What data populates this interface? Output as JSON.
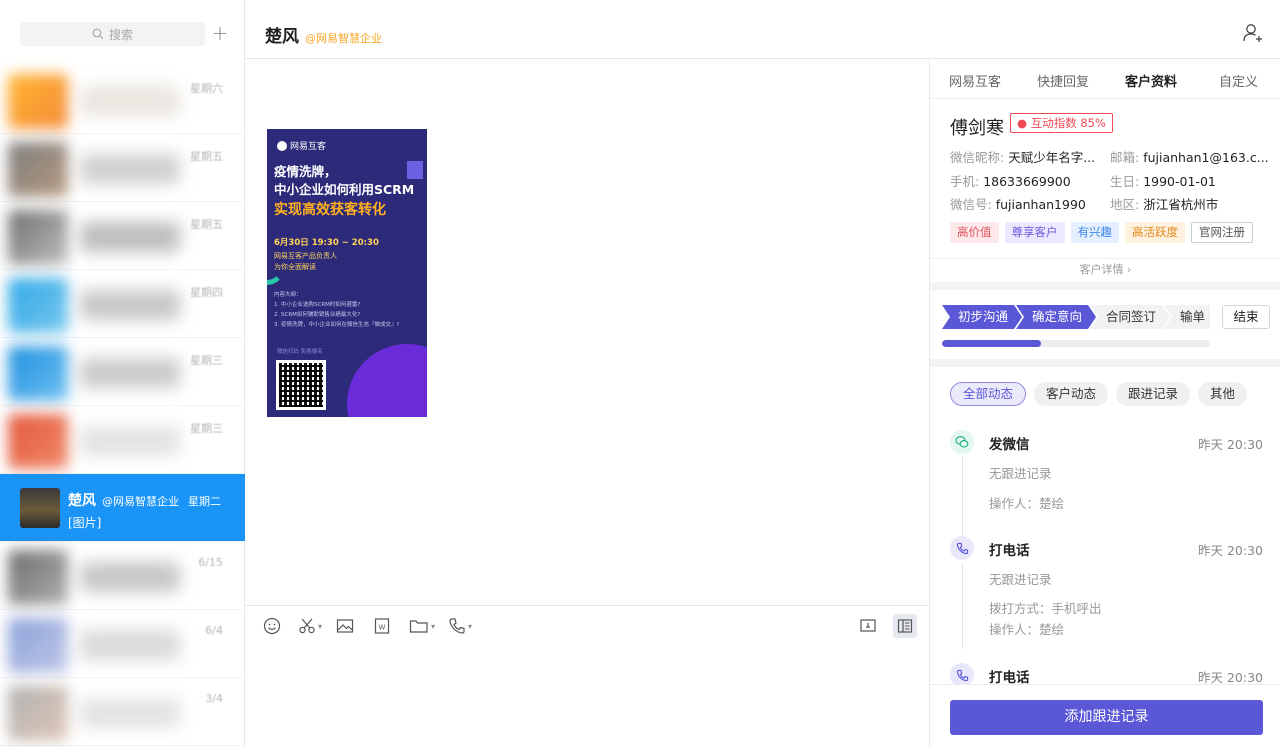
{
  "sidebar": {
    "search_placeholder": "搜索",
    "add_label": "+",
    "conversations": [
      {
        "date": "星期六",
        "colors": [
          "#ffb52e",
          "#f58a3a",
          "#d8d0c5"
        ]
      },
      {
        "date": "星期五",
        "colors": [
          "#7a7a7a",
          "#b99c83",
          "#aaa"
        ]
      },
      {
        "date": "星期五",
        "colors": [
          "#6d6d6d",
          "#c0c0c0",
          "#888"
        ]
      },
      {
        "date": "星期四",
        "colors": [
          "#2fa8e6",
          "#77c7ef",
          "#9a9a9a"
        ]
      },
      {
        "date": "星期三",
        "colors": [
          "#1e90e0",
          "#6ec0f0",
          "#a0a0a0"
        ]
      },
      {
        "date": "星期三",
        "colors": [
          "#e4563a",
          "#f08a6a",
          "#ccc"
        ]
      }
    ],
    "active": {
      "name": "楚风",
      "org": "@网易智慧企业",
      "day": "星期二",
      "message": "[图片]"
    },
    "after": [
      {
        "date": "6/15",
        "colors": [
          "#6d6d6d",
          "#b0b0b0",
          "#999"
        ]
      },
      {
        "date": "6/4",
        "colors": [
          "#8aa0d8",
          "#c0c8e8",
          "#bbb"
        ]
      },
      {
        "date": "3/4",
        "colors": [
          "#b0b0b0",
          "#e0c8b8",
          "#ccc"
        ]
      }
    ]
  },
  "chat": {
    "title": "楚风",
    "org": "@网易智慧企业",
    "poster": {
      "brand": "网易互客",
      "line1": "疫情洗牌，",
      "line2": "中小企业如何利用SCRM",
      "line3": "实现高效获客转化",
      "date": "6月30日  19:30 ~ 20:30",
      "speaker": "网易互客产品负责人",
      "speaker_sub": "为你全面解读",
      "outline_title": "内容大纲：",
      "outline_1": "1. 中小企业选购SCRM时如何避雷?",
      "outline_2": "2. SCRM如何辅助销售业绩最大化?",
      "outline_3": "3. 疫情洗牌，中小企业如何在微信生态『做成交』?",
      "register": "微信扫码  免费报名"
    }
  },
  "right": {
    "tabs": [
      "网易互客",
      "快捷回复",
      "客户资料",
      "自定义"
    ],
    "active_tab": 2,
    "customer": {
      "name": "傅剑寒",
      "score": "互动指数 85%",
      "wechat_nick_label": "微信昵称:",
      "wechat_nick": "天赋少年名字...",
      "email_label": "邮箱:",
      "email": "fujianhan1@163.c...",
      "phone_label": "手机:",
      "phone": "18633669900",
      "birthday_label": "生日:",
      "birthday": "1990-01-01",
      "wechat_id_label": "微信号:",
      "wechat_id": "fujianhan1990",
      "region_label": "地区:",
      "region": "浙江省杭州市"
    },
    "tags": [
      "高价值",
      "尊享客户",
      "有兴趣",
      "高活跃度",
      "官网注册"
    ],
    "detail_link": "客户详情 ›",
    "stages": [
      "初步沟通",
      "确定意向",
      "合同签订",
      "输单"
    ],
    "stages_done": 2,
    "end_label": "结束",
    "progress_percent": 37,
    "filters": [
      "全部动态",
      "客户动态",
      "跟进记录",
      "其他"
    ],
    "timeline": [
      {
        "title": "发微信",
        "time": "昨天 20:30",
        "line1": "无跟进记录",
        "line2": "操作人：楚绘",
        "line3": ""
      },
      {
        "title": "打电话",
        "time": "昨天 20:30",
        "line1": "无跟进记录",
        "line2": "拨打方式：手机呼出",
        "line3": "操作人：楚绘"
      },
      {
        "title": "打电话",
        "time": "昨天 20:30",
        "line1": "",
        "line2": "",
        "line3": ""
      }
    ],
    "add_button": "添加跟进记录"
  }
}
